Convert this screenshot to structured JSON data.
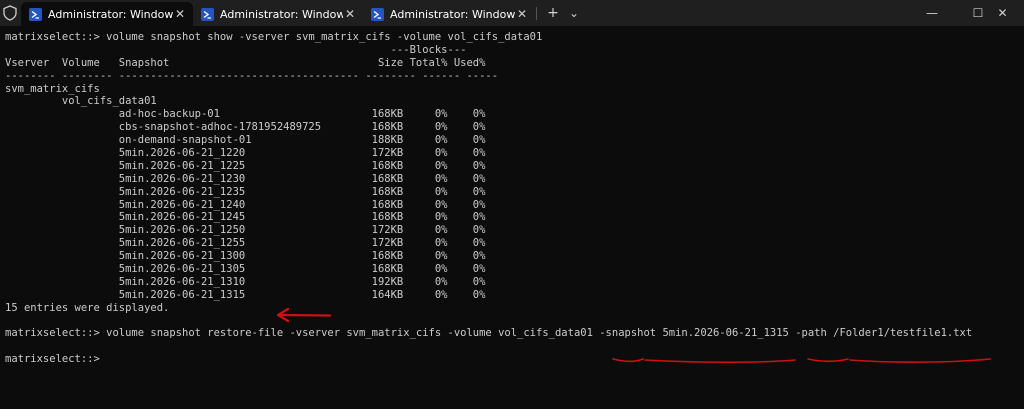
{
  "window": {
    "tabs": [
      {
        "title": "Administrator: Windows Powe",
        "active": true
      },
      {
        "title": "Administrator: Windows Powe",
        "active": false
      },
      {
        "title": "Administrator: Windows Powe",
        "active": false
      }
    ],
    "new_tab_label": "+",
    "dropdown_label": "⌄",
    "minimize_label": "—",
    "maximize_label": "☐",
    "close_label": "✕"
  },
  "terminal": {
    "lines": [
      "matrixselect::> volume snapshot show -vserver svm_matrix_cifs -volume vol_cifs_data01",
      "                                                             ---Blocks---",
      "Vserver  Volume   Snapshot                                 Size Total% Used%",
      "-------- -------- -------------------------------------- -------- ------ -----",
      "svm_matrix_cifs",
      "         vol_cifs_data01",
      "                  ad-hoc-backup-01                        168KB     0%    0%",
      "                  cbs-snapshot-adhoc-1781952489725        168KB     0%    0%",
      "                  on-demand-snapshot-01                   188KB     0%    0%",
      "                  5min.2026-06-21_1220                    172KB     0%    0%",
      "                  5min.2026-06-21_1225                    168KB     0%    0%",
      "                  5min.2026-06-21_1230                    168KB     0%    0%",
      "                  5min.2026-06-21_1235                    168KB     0%    0%",
      "                  5min.2026-06-21_1240                    168KB     0%    0%",
      "                  5min.2026-06-21_1245                    168KB     0%    0%",
      "                  5min.2026-06-21_1250                    172KB     0%    0%",
      "                  5min.2026-06-21_1255                    172KB     0%    0%",
      "                  5min.2026-06-21_1300                    168KB     0%    0%",
      "                  5min.2026-06-21_1305                    168KB     0%    0%",
      "                  5min.2026-06-21_1310                    192KB     0%    0%",
      "                  5min.2026-06-21_1315                    164KB     0%    0%",
      "15 entries were displayed.",
      "",
      "matrixselect::> volume snapshot restore-file -vserver svm_matrix_cifs -volume vol_cifs_data01 -snapshot 5min.2026-06-21_1315 -path /Folder1/testfile1.txt",
      "",
      "matrixselect::>"
    ]
  },
  "colors": {
    "terminal_bg": "#0c0c0c",
    "terminal_fg": "#cccccc",
    "titlebar_bg": "#1f1f1f",
    "annotation_red": "#d01010"
  }
}
